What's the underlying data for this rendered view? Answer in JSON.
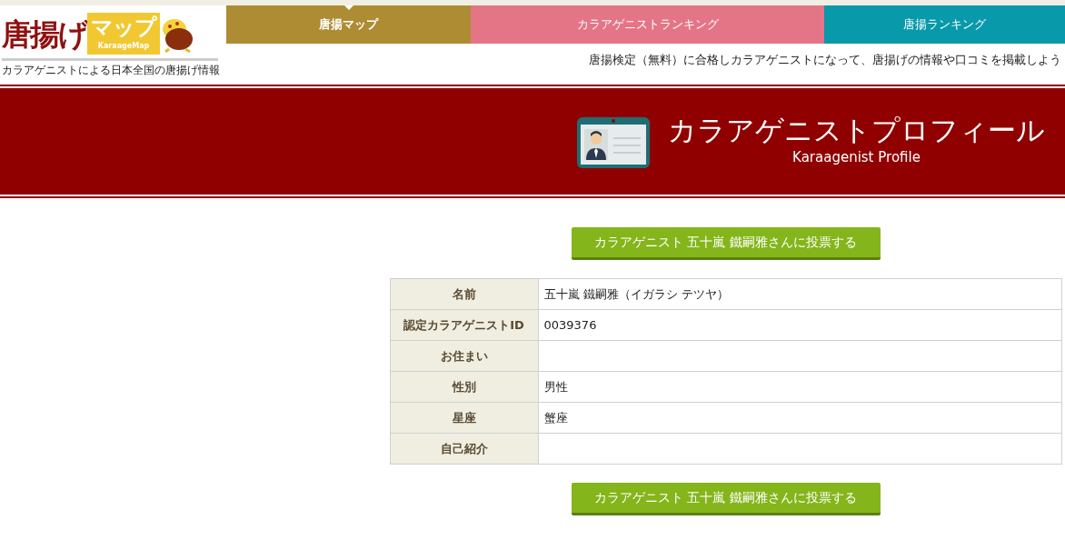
{
  "logo": {
    "main": "唐揚げ",
    "map": "マップ",
    "map_en": "KaraageMap",
    "tagline": "カラアゲニストによる日本全国の唐揚げ情報"
  },
  "nav": [
    {
      "label": "唐揚マップ",
      "selected": true,
      "color": "#ad8c33"
    },
    {
      "label": "カラアゲニストランキング",
      "selected": false,
      "color": "#e47587"
    },
    {
      "label": "唐揚ランキング",
      "selected": false,
      "color": "#0899ab"
    }
  ],
  "header_message": "唐揚検定（無料）に合格しカラアゲニストになって、唐揚げの情報や口コミを掲載しよう",
  "banner": {
    "title": "カラアゲニストプロフィール",
    "subtitle": "Karaagenist Profile"
  },
  "vote_buttons": [
    "カラアゲニスト 五十嵐 鐵嗣雅さんに投票する",
    "カラアゲニスト 五十嵐 鐵嗣雅さんに投票する"
  ],
  "profile": [
    {
      "label": "名前",
      "value": "五十嵐 鐵嗣雅（イガラシ テツヤ）"
    },
    {
      "label": "認定カラアゲニストID",
      "value": "0039376"
    },
    {
      "label": "お住まい"
    },
    {
      "label": "性別",
      "value": "男性"
    },
    {
      "label": "星座",
      "value": "蟹座"
    },
    {
      "label": "自己紹介"
    }
  ]
}
